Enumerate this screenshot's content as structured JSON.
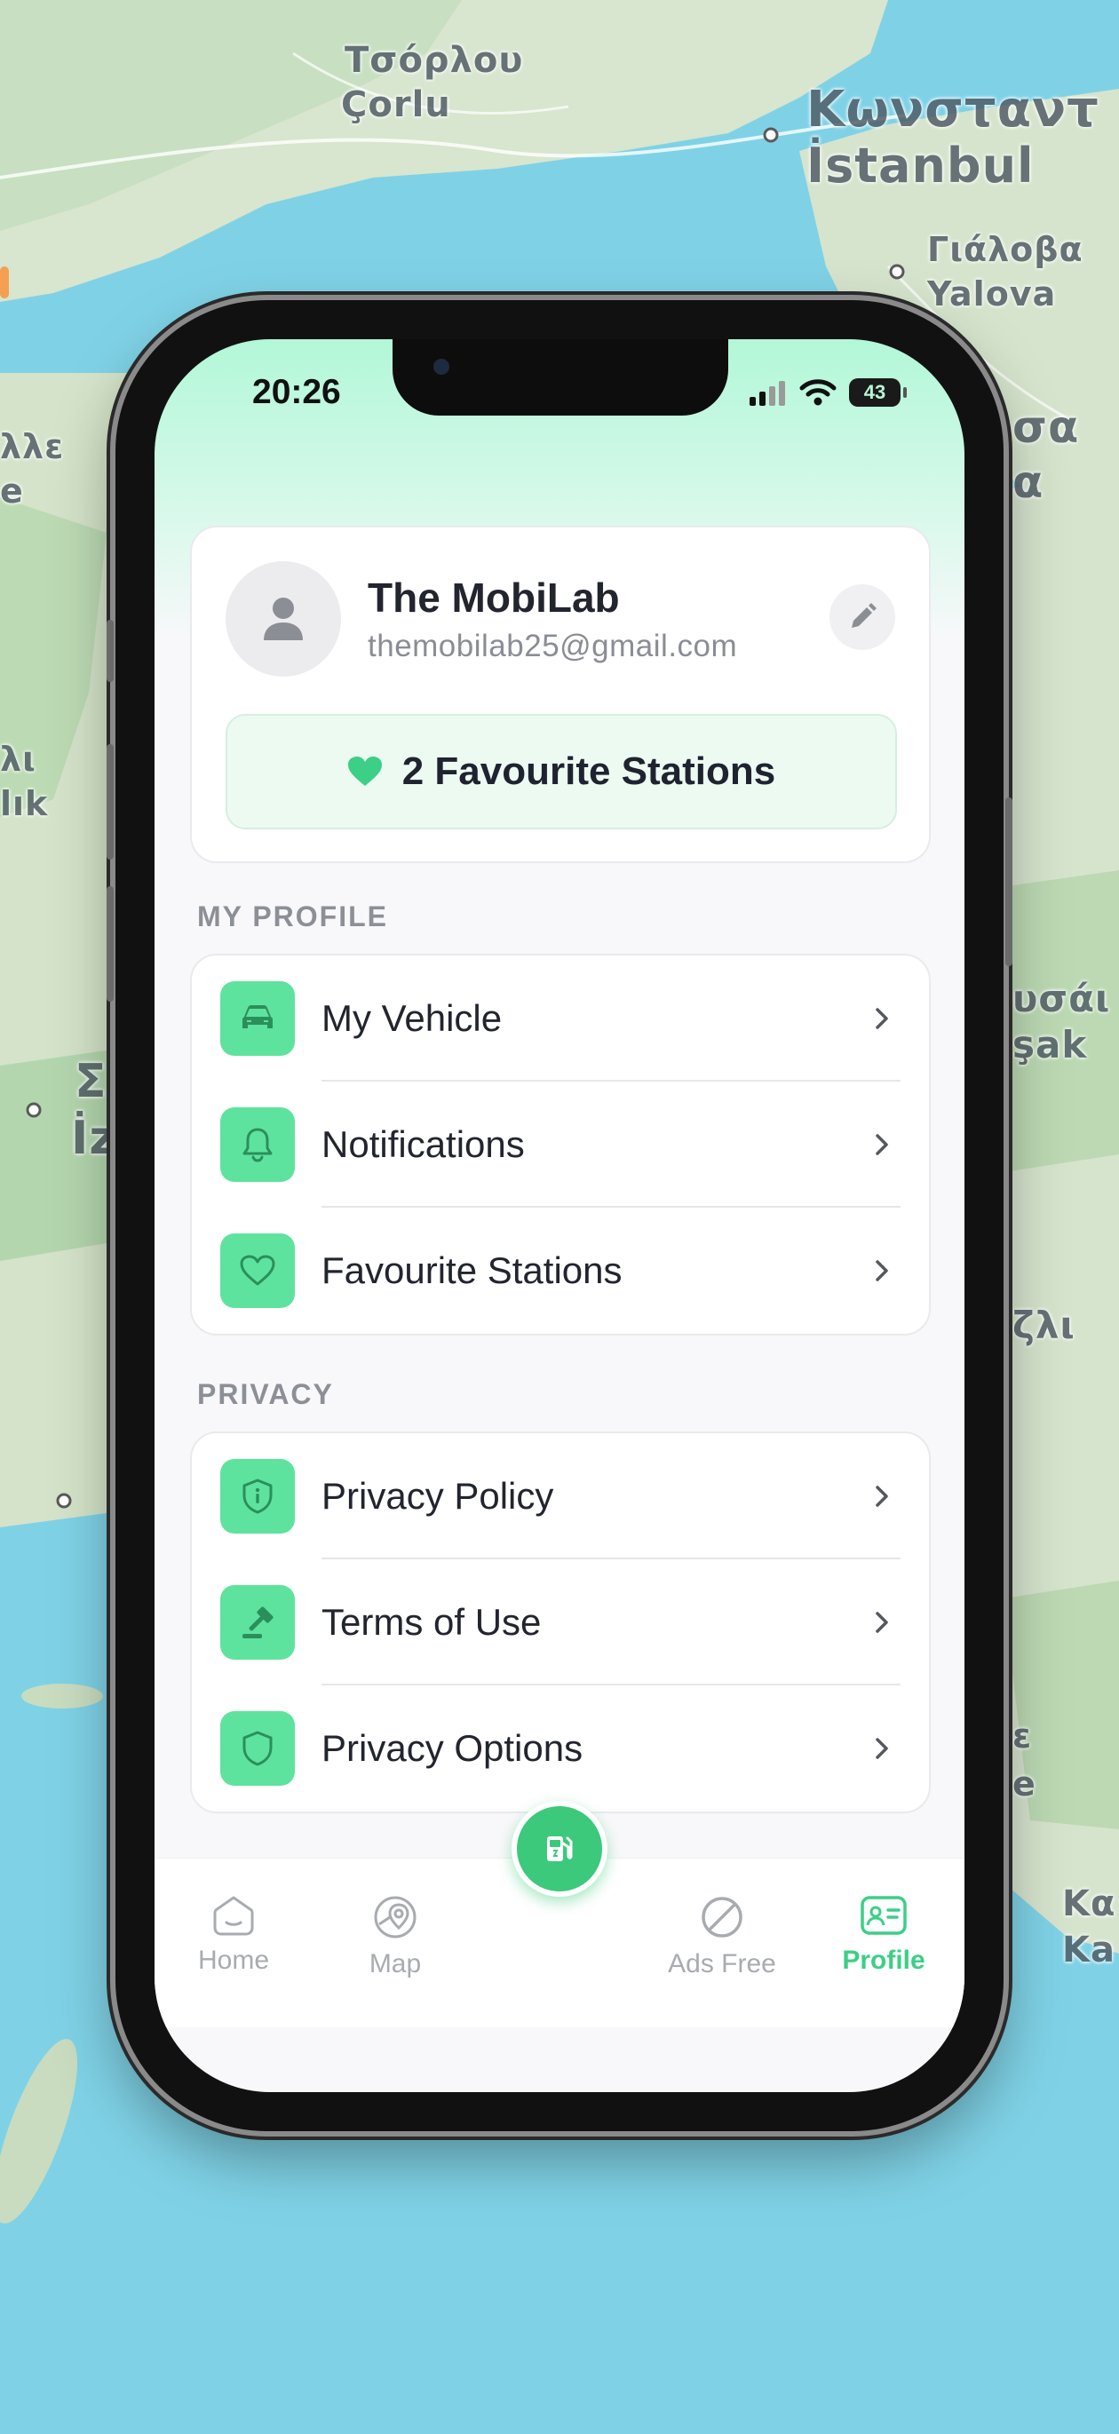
{
  "map": {
    "labels": [
      "Τσόρλου",
      "Çorlu",
      "Κωνσταντ",
      "İstanbul",
      "Γιάλοβα",
      "Yalova",
      "λλε",
      "e",
      "σα",
      "α",
      "λι",
      "lık",
      "Σ",
      "İz",
      "υσάι",
      "şak",
      "ζλι",
      "ε",
      "e",
      "Κα",
      "Ka"
    ]
  },
  "status_bar": {
    "time": "20:26",
    "battery": "43"
  },
  "profile": {
    "name": "The MobiLab",
    "email": "themobilab25@gmail.com",
    "favourites_banner": "2 Favourite Stations"
  },
  "sections": {
    "my_profile": {
      "title": "MY PROFILE",
      "items": [
        {
          "label": "My Vehicle",
          "icon": "car-icon"
        },
        {
          "label": "Notifications",
          "icon": "bell-icon"
        },
        {
          "label": "Favourite Stations",
          "icon": "heart-icon"
        }
      ]
    },
    "privacy": {
      "title": "PRIVACY",
      "items": [
        {
          "label": "Privacy Policy",
          "icon": "shield-info-icon"
        },
        {
          "label": "Terms of Use",
          "icon": "gavel-icon"
        },
        {
          "label": "Privacy Options",
          "icon": "shield-icon"
        }
      ]
    }
  },
  "tabbar": {
    "tabs": [
      {
        "label": "Home",
        "icon": "home-icon"
      },
      {
        "label": "Map",
        "icon": "map-pin-icon"
      },
      {
        "label": "Ads Free",
        "icon": "prohibited-icon"
      },
      {
        "label": "Profile",
        "icon": "profile-card-icon"
      }
    ],
    "active": "Profile",
    "center_button_icon": "fuel-station-icon"
  },
  "colors": {
    "accent": "#3ccf86",
    "icon_tile": "#5ee39e",
    "header_gradient": "#b2f7d8",
    "sea": "#7fd2e6",
    "land": "#d9e6d2"
  }
}
